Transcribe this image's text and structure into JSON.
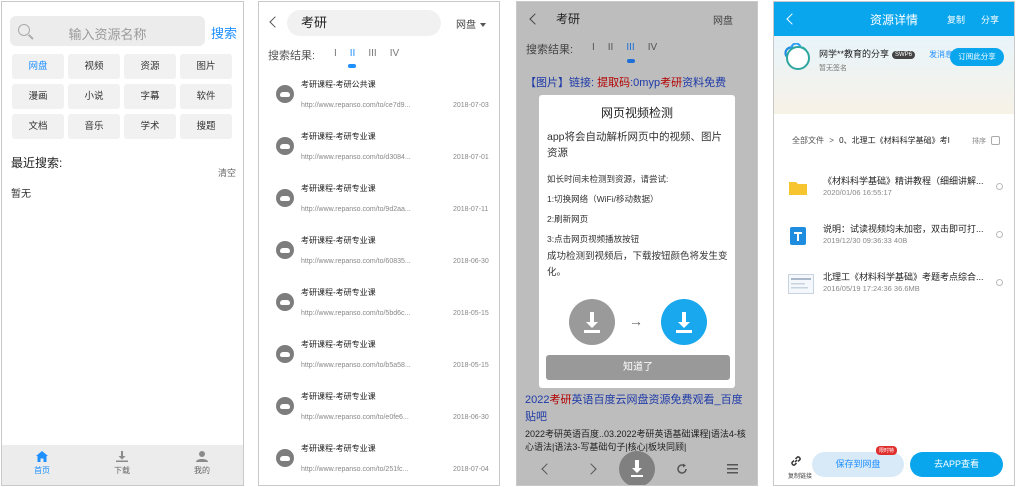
{
  "panel1": {
    "search_placeholder": "输入资源名称",
    "search_button": "搜索",
    "categories": [
      "网盘",
      "视频",
      "资源",
      "图片",
      "漫画",
      "小说",
      "字幕",
      "软件",
      "文档",
      "音乐",
      "学术",
      "搜题"
    ],
    "active_category": "网盘",
    "recent_label": "最近搜索:",
    "clear_label": "清空",
    "empty_label": "暂无",
    "nav": [
      {
        "label": "首页",
        "icon": "home-icon"
      },
      {
        "label": "下载",
        "icon": "download-icon"
      },
      {
        "label": "我的",
        "icon": "person-icon"
      }
    ]
  },
  "panel2": {
    "keyword": "考研",
    "source": "网盘",
    "results_label": "搜索结果:",
    "tabs": [
      "I",
      "II",
      "III",
      "IV"
    ],
    "active_tab": "II",
    "results": [
      {
        "title": "考研课程-考研公共课",
        "url": "http://www.repanso.com/to/ce7d9...",
        "date": "2018-07-03"
      },
      {
        "title": "考研课程-考研专业课",
        "url": "http://www.repanso.com/to/d3084...",
        "date": "2018-07-01"
      },
      {
        "title": "考研课程-考研专业课",
        "url": "http://www.repanso.com/to/9d2aa...",
        "date": "2018-07-11"
      },
      {
        "title": "考研课程-考研专业课",
        "url": "http://www.repanso.com/to/60835...",
        "date": "2018-06-30"
      },
      {
        "title": "考研课程-考研专业课",
        "url": "http://www.repanso.com/to/5bd6c...",
        "date": "2018-05-15"
      },
      {
        "title": "考研课程-考研专业课",
        "url": "http://www.repanso.com/to/b5a58...",
        "date": "2018-05-15"
      },
      {
        "title": "考研课程-考研专业课",
        "url": "http://www.repanso.com/to/e0fe6...",
        "date": "2018-06-30"
      },
      {
        "title": "考研课程-考研专业课",
        "url": "http://www.repanso.com/to/251fc...",
        "date": "2018-07-04"
      }
    ]
  },
  "panel3": {
    "keyword": "考研",
    "source": "网盘",
    "results_label": "搜索结果:",
    "tabs": [
      "I",
      "II",
      "III",
      "IV"
    ],
    "bg_line1a": "【图片】链接: ",
    "bg_line1b": "提取码",
    "bg_line1c": ":0myp",
    "bg_line1d": "考研",
    "bg_line1e": "资料免费",
    "bg_bottom_title_a": "2022",
    "bg_bottom_title_b": "考研",
    "bg_bottom_title_c": "英语百度云网盘资源免费观看_百度贴吧",
    "bg_bottom_body": "2022考研英语百度..03.2022考研英语基础课程|语法4-核心语法|语法3-写基础句子|核心|板块同顾|",
    "modal": {
      "title": "网页视频检测",
      "intro": "app将会自动解析网页中的视频、图片资源",
      "hint": "如长时间未检测到资源，请尝试:",
      "step1": "1:切换网络（WiFi/移动数据）",
      "step2": "2:刷新网页",
      "step3": "3:点击网页视频播放按钮",
      "note": "成功检测到视频后，下载按钮颜色将发生变化。",
      "button": "知道了"
    }
  },
  "panel4": {
    "title": "资源详情",
    "copy_label": "复制",
    "share_label": "分享",
    "user_name": "网学**教育的分享",
    "vip_badge": "SWP6",
    "follow_label": "发消息",
    "subscribe_label": "订阅此分享",
    "intro": "暂无签名",
    "breadcrumb_root": "全部文件",
    "breadcrumb_sep": ">",
    "breadcrumb_current": "0、北理工《材料科学基础》考I",
    "sort_label": "排序",
    "files": [
      {
        "name": "《材料科学基础》精讲教程（细细讲解...",
        "meta": "2020/01/06 16:55:17",
        "type": "folder-icon"
      },
      {
        "name": "说明：试读视频均未加密，双击即可打...",
        "meta": "2019/12/30 09:36:33   40B",
        "type": "document-icon"
      },
      {
        "name": "北理工《材料科学基础》考题考点综合...",
        "meta": "2016/05/19 17:24:36   36.6MB",
        "type": "image-file-icon"
      }
    ],
    "link_label": "复制链接",
    "save_button": "保存到网盘",
    "save_badge": "限时特",
    "app_button": "去APP查看",
    "brand_color": "#09a6ee"
  }
}
